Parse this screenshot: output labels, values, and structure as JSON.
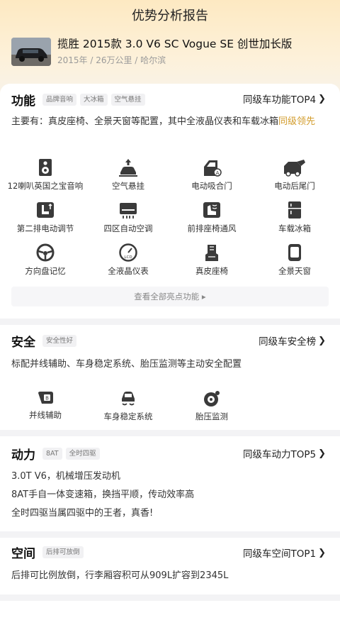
{
  "page": {
    "title": "优势分析报告"
  },
  "car": {
    "title": "揽胜 2015款 3.0 V6 SC Vogue SE 创世加长版",
    "meta": "2015年 / 26万公里 / 哈尔滨"
  },
  "function": {
    "name": "功能",
    "tags": [
      "品牌音响",
      "大冰箱",
      "空气悬挂"
    ],
    "link": "同级车功能TOP4",
    "desc_prefix": "主要有：真皮座椅、全景天窗等配置，其中全液晶仪表和车载冰箱",
    "desc_highlight": "同级领先",
    "items": [
      {
        "label": "12喇叭英国之宝音响",
        "icon": "speaker-icon"
      },
      {
        "label": "空气悬挂",
        "icon": "air-suspension-icon"
      },
      {
        "label": "电动吸合门",
        "icon": "soft-close-door-icon"
      },
      {
        "label": "电动后尾门",
        "icon": "power-tailgate-icon"
      },
      {
        "label": "第二排电动调节",
        "icon": "rear-seat-adjust-icon"
      },
      {
        "label": "四区自动空调",
        "icon": "climate-control-icon"
      },
      {
        "label": "前排座椅通风",
        "icon": "seat-ventilation-icon"
      },
      {
        "label": "车载冰箱",
        "icon": "fridge-icon"
      },
      {
        "label": "方向盘记忆",
        "icon": "steering-wheel-icon"
      },
      {
        "label": "全液晶仪表",
        "icon": "lcd-cluster-icon"
      },
      {
        "label": "真皮座椅",
        "icon": "leather-seat-icon"
      },
      {
        "label": "全景天窗",
        "icon": "panoramic-sunroof-icon"
      }
    ],
    "more": "查看全部亮点功能 ▸"
  },
  "safety": {
    "name": "安全",
    "tags": [
      "安全性好"
    ],
    "link": "同级车安全榜",
    "desc": "标配并线辅助、车身稳定系统、胎压监测等主动安全配置",
    "items": [
      {
        "label": "并线辅助",
        "icon": "lane-assist-icon"
      },
      {
        "label": "车身稳定系统",
        "icon": "stability-control-icon"
      },
      {
        "label": "胎压监测",
        "icon": "tire-pressure-icon"
      }
    ]
  },
  "power": {
    "name": "动力",
    "tags": [
      "8AT",
      "全时四驱"
    ],
    "link": "同级车动力TOP5",
    "lines": [
      "3.0T V6，机械增压发动机",
      "8AT手自一体变速箱，换挡平顺，传动效率高",
      "全时四驱当属四驱中的王者，真香!"
    ]
  },
  "space": {
    "name": "空间",
    "tags": [
      "后排可放倒"
    ],
    "link": "同级车空间TOP1",
    "desc": "后排可比例放倒，行李厢容积可从909L扩容到2345L"
  },
  "colors": {
    "accent": "#d29c2c",
    "hero_top": "#fde9c2",
    "icon": "#3a3a3a"
  }
}
